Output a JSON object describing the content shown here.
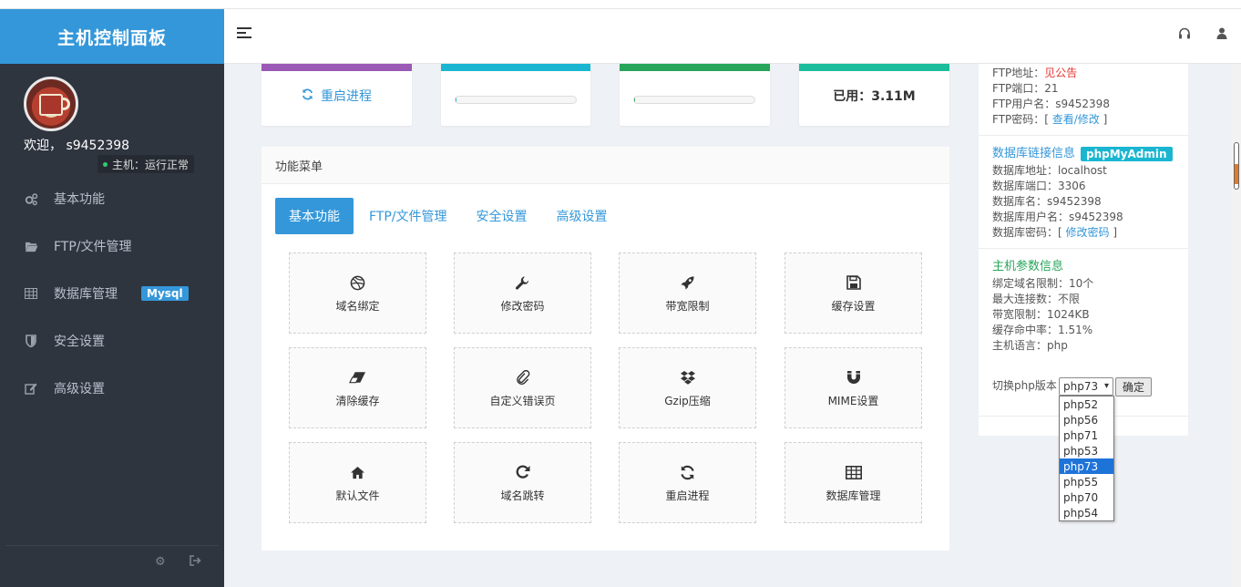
{
  "brand": "主机控制面板",
  "user": {
    "welcome": "欢迎， s9452398",
    "status": "主机：运行正常"
  },
  "nav": [
    {
      "label": "基本功能",
      "icon": "cogs-icon"
    },
    {
      "label": "FTP/文件管理",
      "icon": "folder-open-icon"
    },
    {
      "label": "数据库管理",
      "icon": "table-icon",
      "badge": "Mysql"
    },
    {
      "label": "安全设置",
      "icon": "shield-icon"
    },
    {
      "label": "高级设置",
      "icon": "edit-icon"
    }
  ],
  "cards": {
    "restart": "重启进程",
    "used": "已用：3.11M",
    "progress1": 0.01,
    "progress2": 0.01,
    "colors": [
      "#9b59b6",
      "#1ab6d1",
      "#27a55a",
      "#1abc9c"
    ]
  },
  "panel": {
    "title": "功能菜单",
    "tabs": [
      "基本功能",
      "FTP/文件管理",
      "安全设置",
      "高级设置"
    ],
    "tiles": [
      {
        "label": "域名绑定",
        "icon": "dribbble-icon"
      },
      {
        "label": "修改密码",
        "icon": "wrench-icon"
      },
      {
        "label": "带宽限制",
        "icon": "rocket-icon"
      },
      {
        "label": "缓存设置",
        "icon": "save-icon"
      },
      {
        "label": "清除缓存",
        "icon": "eraser-icon"
      },
      {
        "label": "自定义错误页",
        "icon": "paperclip-icon"
      },
      {
        "label": "Gzip压缩",
        "icon": "dropbox-icon"
      },
      {
        "label": "MIME设置",
        "icon": "magnet-icon"
      },
      {
        "label": "默认文件",
        "icon": "home-icon"
      },
      {
        "label": "域名跳转",
        "icon": "redo-icon"
      },
      {
        "label": "重启进程",
        "icon": "refresh-icon"
      },
      {
        "label": "数据库管理",
        "icon": "table-icon"
      }
    ]
  },
  "info": {
    "ftp": {
      "addr_label": "FTP地址：",
      "addr_value": "见公告",
      "port": "FTP端口：21",
      "user": "FTP用户名：s9452398",
      "pwd_prefix": "FTP密码：[ ",
      "pwd_link": "查看/修改",
      "pwd_suffix": " ]"
    },
    "db": {
      "title": "数据库链接信息",
      "badge": "phpMyAdmin",
      "addr": "数据库地址：localhost",
      "port": "数据库端口：3306",
      "name": "数据库名：s9452398",
      "user": "数据库用户名：s9452398",
      "pwd_prefix": "数据库密码：[ ",
      "pwd_link": "修改密码",
      "pwd_suffix": " ]"
    },
    "host": {
      "title": "主机参数信息",
      "domains": "绑定域名限制：10个",
      "conn": "最大连接数：不限",
      "bw": "带宽限制：1024KB",
      "cache": "缓存命中率：1.51%",
      "lang": "主机语言：php"
    },
    "php": {
      "label": "切换php版本：",
      "selected": "php73",
      "confirm": "确定",
      "options": [
        "php52",
        "php56",
        "php71",
        "php53",
        "php73",
        "php55",
        "php70",
        "php54"
      ]
    }
  }
}
